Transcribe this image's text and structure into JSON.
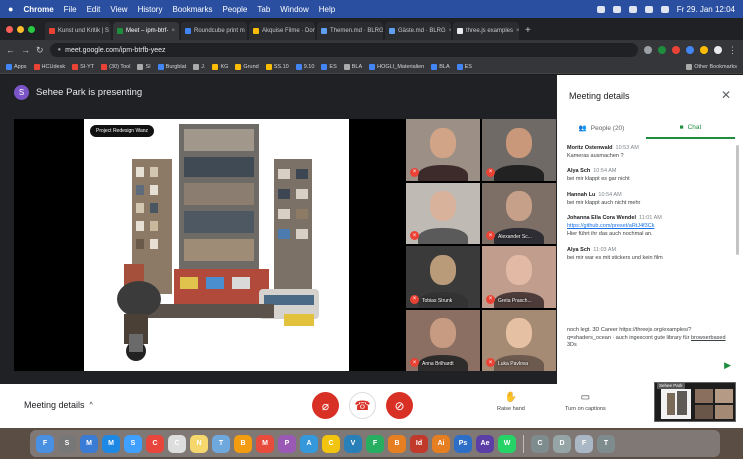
{
  "menubar": {
    "app": "Chrome",
    "items": [
      "File",
      "Edit",
      "View",
      "History",
      "Bookmarks",
      "People",
      "Tab",
      "Window",
      "Help"
    ],
    "clock": "Fr 29. Jan 12:04"
  },
  "tabs": [
    {
      "label": "Kunst und Kritik | S",
      "color": "#ea4335"
    },
    {
      "label": "Meet – ipm-btrf-",
      "color": "#1e8e3e",
      "active": true
    },
    {
      "label": "Roundcube print m",
      "color": "#4285f4"
    },
    {
      "label": "Akquise Filme · Don",
      "color": "#fbbc04"
    },
    {
      "label": "Themen.md · BLRG",
      "color": "#5f9ef0"
    },
    {
      "label": "Gäste.md · BLRG",
      "color": "#5f9ef0"
    },
    {
      "label": "three.js examples",
      "color": "#e8eaed"
    }
  ],
  "address": {
    "url": "meet.google.com/ipm-btrfb-yeez"
  },
  "bookmarks": [
    {
      "label": "Apps",
      "color": "#4285f4"
    },
    {
      "label": "HCUdesk",
      "color": "#ea4335"
    },
    {
      "label": "SI-YT",
      "color": "#ea4335"
    },
    {
      "label": "(30) Tool",
      "color": "#ea4335"
    },
    {
      "label": "SI",
      "color": "#aaaaaa"
    },
    {
      "label": "Burgblat",
      "color": "#4285f4"
    },
    {
      "label": "J.",
      "color": "#aaaaaa"
    },
    {
      "label": "KG",
      "color": "#fbbc04"
    },
    {
      "label": "Grund",
      "color": "#fbbc04"
    },
    {
      "label": "SS.10",
      "color": "#fbbc04"
    },
    {
      "label": "9.10",
      "color": "#4285f4"
    },
    {
      "label": "ES",
      "color": "#4285f4"
    },
    {
      "label": "BLA",
      "color": "#aaaaaa"
    },
    {
      "label": "HOGLI_Materialien",
      "color": "#4285f4"
    },
    {
      "label": "BLA",
      "color": "#4285f4"
    },
    {
      "label": "ES",
      "color": "#4285f4"
    },
    {
      "label": "Other Bookmarks",
      "color": "#aaaaaa"
    }
  ],
  "presenter": {
    "initial": "S",
    "text": "Sehee Park is presenting"
  },
  "slide": {
    "tag": "Project Redesign Wanz"
  },
  "participants": [
    {
      "name": "",
      "skin": "#d2a487",
      "shirt": "#3d2b2b",
      "bg": "#9b8f86"
    },
    {
      "name": "",
      "skin": "#c9977a",
      "shirt": "#222222",
      "bg": "#6f6a66"
    },
    {
      "name": "",
      "skin": "#d8b29a",
      "shirt": "#5a5a5a",
      "bg": "#bfbab4"
    },
    {
      "name": "Alexander Sc...",
      "skin": "#c7a08a",
      "shirt": "#2d2d33",
      "bg": "#7d6f66"
    },
    {
      "name": "Tobias Strunk",
      "skin": "#b99b7a",
      "shirt": "#333333",
      "bg": "#3a3a3a"
    },
    {
      "name": "Greta Prasch...",
      "skin": "#e2b9a5",
      "shirt": "#4c3b39",
      "bg": "#c09d8d"
    },
    {
      "name": "Anna Brilhardt",
      "skin": "#c79a82",
      "shirt": "#2f2c2c",
      "bg": "#8a6f62"
    },
    {
      "name": "Luka Pavlova",
      "skin": "#e6c0a2",
      "shirt": "#6d5a4e",
      "bg": "#a68b74"
    }
  ],
  "panel": {
    "title": "Meeting details",
    "tab_people": "People (20)",
    "tab_chat": "Chat",
    "messages": [
      {
        "author": "Moritz Ostenwald",
        "time": "10:53 AM",
        "text": "Kameras ausmachen ?",
        "link": ""
      },
      {
        "author": "Alya Sch",
        "time": "10:54 AM",
        "text": "bei mir klappt es gar nicht",
        "link": ""
      },
      {
        "author": "Hannah Lu",
        "time": "10:54 AM",
        "text": "bei mir klappt auch nicht mehr",
        "link": ""
      },
      {
        "author": "Johanna Ella Cora Wendel",
        "time": "11:01 AM",
        "text": "Hier führt ihr das auch nochmal an.",
        "link": "https://github.com/preset/aRtJ4f3Ck"
      },
      {
        "author": "Alya Sch",
        "time": "11:03 AM",
        "text": "bei mir war es mit stickers und kein film",
        "link": ""
      }
    ],
    "long_msg": "noch legt. 3D Career https://threejs.org/examples/?q=shaders_ocean · auch ingescont gute library für",
    "long_msg_link": "browserbased",
    "long_msg_tail": " 3Ds"
  },
  "controls": {
    "meeting_details": "Meeting details",
    "raise_hand": "Raise hand",
    "captions": "Turn on captions",
    "pip_label": "Sehee Park"
  },
  "dock": [
    {
      "label": "F",
      "color": "#4a90e2"
    },
    {
      "label": "S",
      "color": "#777777"
    },
    {
      "label": "M",
      "color": "#3a7bd5"
    },
    {
      "label": "M",
      "color": "#1e88e5"
    },
    {
      "label": "S",
      "color": "#40a0ff"
    },
    {
      "label": "C",
      "color": "#e8453c"
    },
    {
      "label": "C",
      "color": "#dddddd"
    },
    {
      "label": "N",
      "color": "#f5d76e"
    },
    {
      "label": "T",
      "color": "#6fa8dc"
    },
    {
      "label": "B",
      "color": "#f39c12"
    },
    {
      "label": "M",
      "color": "#e74c3c"
    },
    {
      "label": "P",
      "color": "#9b59b6"
    },
    {
      "label": "A",
      "color": "#3498db"
    },
    {
      "label": "C",
      "color": "#f1c40f"
    },
    {
      "label": "V",
      "color": "#2980b9"
    },
    {
      "label": "F",
      "color": "#27ae60"
    },
    {
      "label": "B",
      "color": "#e67e22"
    },
    {
      "label": "Id",
      "color": "#c0392b"
    },
    {
      "label": "Ai",
      "color": "#e67e22"
    },
    {
      "label": "Ps",
      "color": "#2d6ec7"
    },
    {
      "label": "Ae",
      "color": "#5b3fa6"
    },
    {
      "label": "W",
      "color": "#25d366"
    },
    {
      "label": "C",
      "color": "#7f8c8d"
    },
    {
      "label": "D",
      "color": "#95a5a6"
    },
    {
      "label": "F",
      "color": "#aab7c4"
    },
    {
      "label": "T",
      "color": "#7f8c8d"
    }
  ]
}
